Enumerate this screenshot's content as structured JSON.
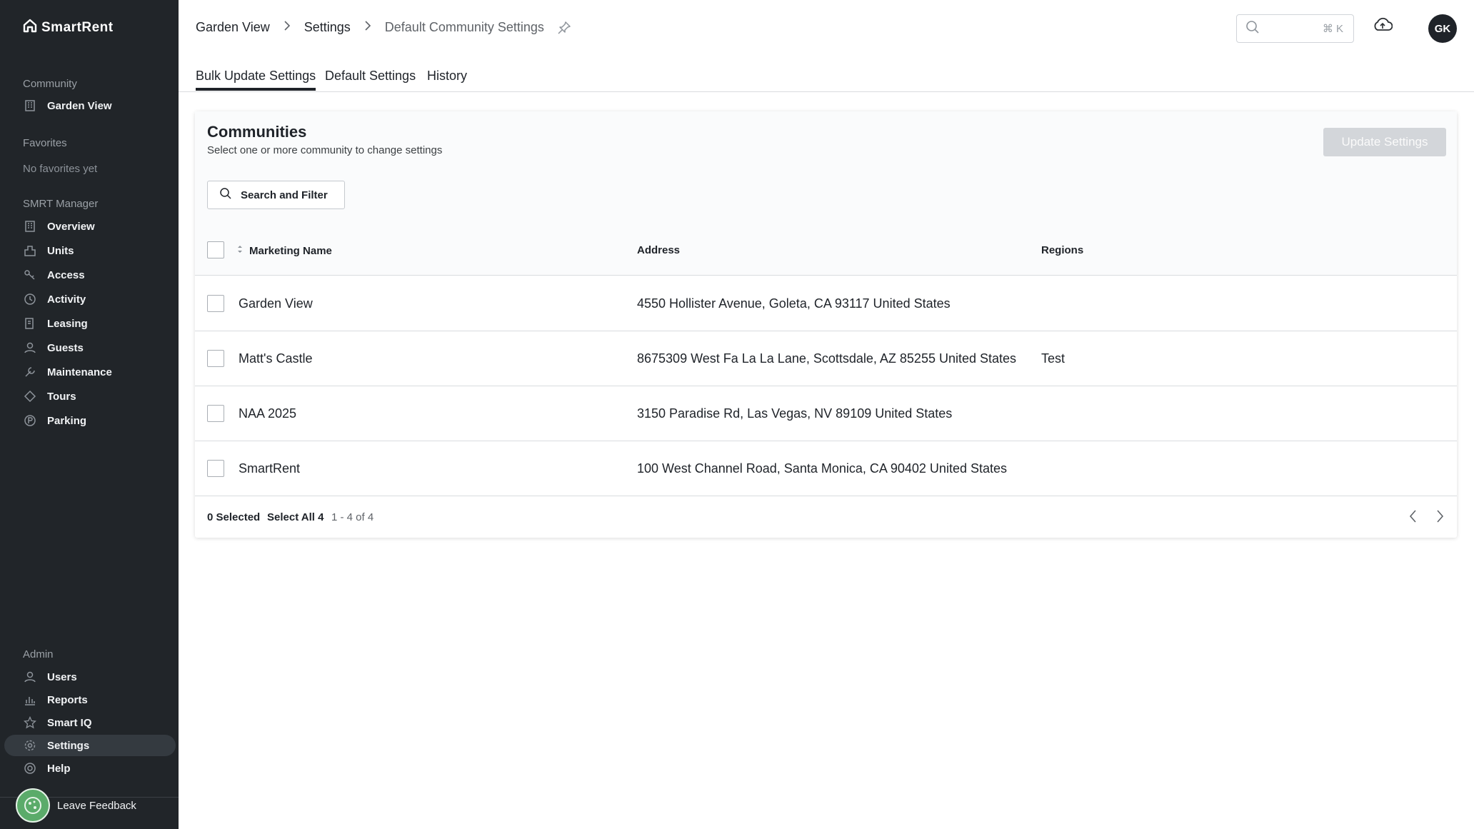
{
  "brand": {
    "name": "SmartRent"
  },
  "sidebar": {
    "community_label": "Community",
    "community_name": "Garden View",
    "favorites_label": "Favorites",
    "favorites_empty": "No favorites yet",
    "manager_label": "SMRT Manager",
    "manager_items": [
      {
        "label": "Overview",
        "icon": "building-icon"
      },
      {
        "label": "Units",
        "icon": "units-icon"
      },
      {
        "label": "Access",
        "icon": "key-icon"
      },
      {
        "label": "Activity",
        "icon": "activity-icon"
      },
      {
        "label": "Leasing",
        "icon": "leasing-icon"
      },
      {
        "label": "Guests",
        "icon": "guests-icon"
      },
      {
        "label": "Maintenance",
        "icon": "wrench-icon"
      },
      {
        "label": "Tours",
        "icon": "tours-icon"
      },
      {
        "label": "Parking",
        "icon": "parking-icon"
      }
    ],
    "admin_label": "Admin",
    "admin_items": [
      {
        "label": "Users",
        "icon": "users-icon"
      },
      {
        "label": "Reports",
        "icon": "reports-icon"
      },
      {
        "label": "Smart IQ",
        "icon": "star-icon"
      },
      {
        "label": "Settings",
        "icon": "gear-icon",
        "active": true
      },
      {
        "label": "Help",
        "icon": "help-icon"
      }
    ],
    "feedback_label": "Leave Feedback"
  },
  "header": {
    "breadcrumb": [
      "Garden View",
      "Settings",
      "Default Community Settings"
    ],
    "search_shortcut": "⌘ K",
    "avatar_initials": "GK"
  },
  "tabs": [
    {
      "label": "Bulk Update Settings",
      "active": true
    },
    {
      "label": "Default Settings",
      "active": false
    },
    {
      "label": "History",
      "active": false
    }
  ],
  "card": {
    "title": "Communities",
    "subtitle": "Select one or more community to change settings",
    "update_button": "Update Settings",
    "filter_button": "Search and Filter"
  },
  "table": {
    "columns": [
      "Marketing Name",
      "Address",
      "Regions"
    ],
    "rows": [
      {
        "name": "Garden View",
        "address": "4550 Hollister Avenue, Goleta, CA 93117 United States",
        "region": ""
      },
      {
        "name": "Matt's Castle",
        "address": "8675309 West Fa La La Lane, Scottsdale, AZ 85255 United States",
        "region": "Test"
      },
      {
        "name": "NAA 2025",
        "address": "3150 Paradise Rd, Las Vegas, NV 89109 United States",
        "region": ""
      },
      {
        "name": "SmartRent",
        "address": "100 West Channel Road, Santa Monica, CA 90402 United States",
        "region": ""
      }
    ]
  },
  "footer": {
    "selected": "0 Selected",
    "select_all": "Select All 4",
    "range": "1 - 4 of 4"
  },
  "colors": {
    "sidebar_bg": "#212529",
    "active_item_bg": "#343a40",
    "disabled_button": "#d3d6da",
    "feedback_green": "#5bab6a"
  }
}
